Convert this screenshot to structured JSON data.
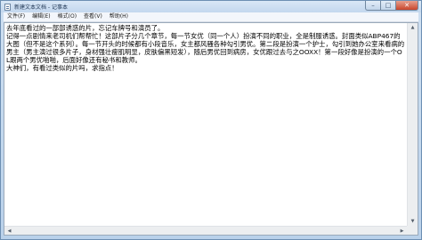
{
  "window": {
    "title": "新建文本文档 - 记事本"
  },
  "caption": {
    "minimize": "–",
    "maximize": "□",
    "close": "✕"
  },
  "menu": {
    "items": [
      {
        "label": "文件(F)"
      },
      {
        "label": "编辑(E)"
      },
      {
        "label": "格式(O)"
      },
      {
        "label": "查看(V)"
      },
      {
        "label": "帮助(H)"
      }
    ]
  },
  "editor": {
    "content": "去年底看过的一部部诱惑的片，忘记车牌号和演员了。\n记得一点剧情来老司机们帮帮忙！这部片子分几个章节，每一节女优（同一个人）扮演不同的职业，全是制服诱惑。封面类似ABP467的大图（但不是这个系列）。每一节开头的时候都有小段音乐，女主都风骚各种勾引男优。第二段是扮演一个护士，勾引到她办公室来看病的男主（男主演过很多片子，身材强壮瘦肌明显，皮肤偏黑短发），随后男优回到病房，女优跟过去与之OOXX！第一段好像是扮演的一个OL跟两个男优啪啪，后面好像还有秘书和教师。\n大神们，有看过类似的片吗，求指点！"
  },
  "scrollbars": {
    "up_arrow": "▲",
    "down_arrow": "▼",
    "left_arrow": "◀",
    "right_arrow": "▶"
  }
}
